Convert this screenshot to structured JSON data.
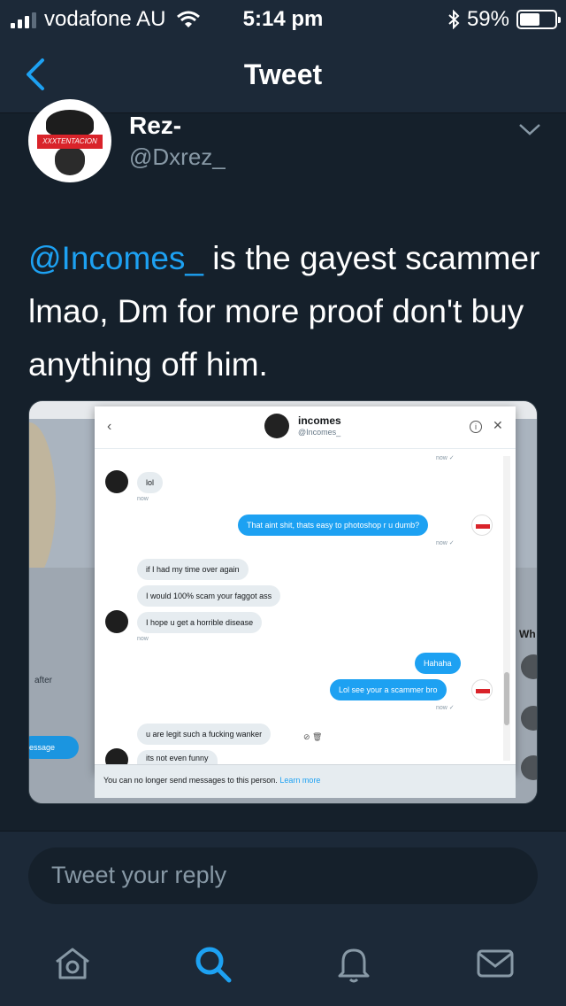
{
  "status_bar": {
    "carrier": "vodafone AU",
    "time": "5:14 pm",
    "battery": "59%",
    "battery_level": 0.59
  },
  "header": {
    "title": "Tweet"
  },
  "tweet": {
    "name": "Rez-",
    "handle": "@Dxrez_",
    "avatar_banner": "XXXTENTACION",
    "mention": "@Incomes_",
    "text": " is the gayest scammer lmao, Dm for more proof don't buy anything off him."
  },
  "screenshot": {
    "bg_after": "after",
    "bg_message_btn": "essage",
    "bg_wh": "Wh",
    "dm_name": "incomes",
    "dm_handle": "@Incomes_",
    "messages": [
      {
        "dir": "in",
        "text": "lol",
        "meta": "now"
      },
      {
        "dir": "out",
        "text": "That aint shit, thats easy to photoshop r u dumb?",
        "meta": "now ✓"
      },
      {
        "dir": "in",
        "text": "if I had my time over again"
      },
      {
        "dir": "in",
        "text": "I would 100% scam your faggot ass"
      },
      {
        "dir": "in",
        "text": "I hope u get a horrible disease",
        "meta": "now"
      },
      {
        "dir": "out",
        "text": "Hahaha"
      },
      {
        "dir": "out",
        "text": "Lol see your a scammer bro",
        "meta": "now ✓"
      },
      {
        "dir": "in",
        "text": "u are legit such a fucking wanker"
      },
      {
        "dir": "in",
        "text": "its not even funny"
      }
    ],
    "top_meta": "now ✓",
    "footer_text": "You can no longer send messages to this person.",
    "footer_link": "Learn more"
  },
  "reply": {
    "placeholder": "Tweet your reply"
  },
  "tabs": [
    {
      "icon": "home-icon"
    },
    {
      "icon": "search-icon"
    },
    {
      "icon": "notifications-icon"
    },
    {
      "icon": "messages-icon"
    }
  ],
  "colors": {
    "background": "#15202b",
    "bar": "#1c2938",
    "accent": "#1da1f2",
    "muted": "#8899a6"
  }
}
